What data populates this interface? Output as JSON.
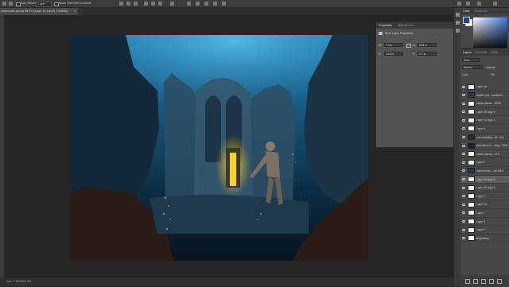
{
  "options_bar": {
    "auto_select_label": "Auto-Select:",
    "auto_select_target": "Layer",
    "show_transform_label": "Show Transform Controls"
  },
  "document_tab": {
    "title": "underwater.psd @ 58.2% (Layer 15 copy 6, RGB/8#)",
    "close": "×"
  },
  "status_bar": {
    "text": "Doc: 7.99M/502.6M"
  },
  "properties_panel": {
    "tabs": [
      "Properties",
      "Adjustments"
    ],
    "subtitle": "Pixel Layer Properties",
    "w_label": "W:",
    "w_value": "7.9 in",
    "h_label": "H:",
    "h_value": "6.51 in",
    "x_label": "X:",
    "x_value": "3.12 in",
    "y_label": "Y:",
    "y_value": "2.7 in"
  },
  "color_panel": {
    "tabs": [
      "Color",
      "Swatches"
    ],
    "colors": {
      "foreground": "#1e4a8c",
      "background": "#ffffff",
      "accent": "#3e78d8"
    }
  },
  "layers_panel": {
    "tabs": [
      "Layers",
      "Channels",
      "Paths"
    ],
    "kind_filter": "Kind",
    "blend_mode": "Screen",
    "opacity_label": "Opacity:",
    "lock_label": "Lock:",
    "fill_label": "Fill:",
    "layers": [
      {
        "name": "Layer 18",
        "thumb": "checker",
        "selected": false
      },
      {
        "name": "shutter-ynz...scrubbed",
        "thumb": "#1c3c5a",
        "selected": false
      },
      {
        "name": "ocean-waves...-6000",
        "thumb": "checker",
        "selected": false
      },
      {
        "name": "Layer 15 copy 5",
        "thumb": "checker",
        "selected": false
      },
      {
        "name": "Layer 15 copy 4",
        "thumb": "checker",
        "selected": false
      },
      {
        "name": "Layer 6",
        "thumb": "checker",
        "selected": false
      },
      {
        "name": "man-standing...0fr...001",
        "thumb": "#2a2a2a",
        "selected": false
      },
      {
        "name": "silhouet-of-a-...dong...2004",
        "thumb": "#0e2438",
        "selected": false
      },
      {
        "name": "ocean-waves...-of-0",
        "thumb": "checker",
        "selected": false
      },
      {
        "name": "Layer 9",
        "thumb": "checker",
        "selected": false
      },
      {
        "name": "man-in-blue-...ant-0401",
        "thumb": "#1a3a58",
        "selected": false
      },
      {
        "name": "Layer 15 copy 6",
        "thumb": "checker",
        "selected": true
      },
      {
        "name": "Layer 15 copy 3",
        "thumb": "checker",
        "selected": false
      },
      {
        "name": "Layer 8",
        "thumb": "checker",
        "selected": false
      },
      {
        "name": "Layer 10",
        "thumb": "checker",
        "selected": false
      },
      {
        "name": "Layer 7",
        "thumb": "checker",
        "selected": false
      },
      {
        "name": "Layer 3",
        "thumb": "checker",
        "selected": false
      },
      {
        "name": "Layer 4",
        "thumb": "checker",
        "selected": false
      },
      {
        "name": "Brightness...",
        "thumb": "#ffffff",
        "selected": false
      }
    ]
  },
  "artwork": {
    "description_colors": {
      "water_top": "#1d6e9e",
      "water_dark": "#0a1e2c",
      "glow": "#ffd21f"
    }
  }
}
